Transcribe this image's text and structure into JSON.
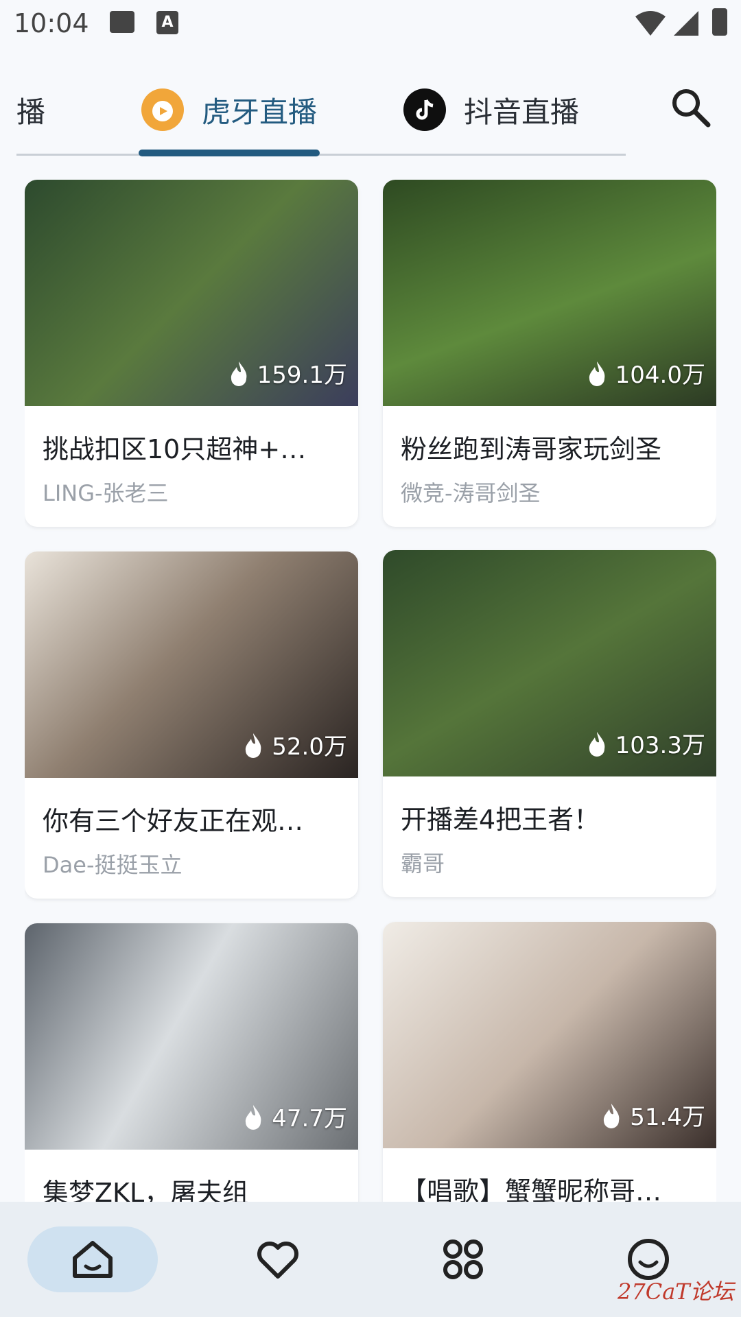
{
  "status_bar": {
    "time": "10:04",
    "icons": [
      "image-icon",
      "font-a-icon",
      "wifi-icon",
      "signal-icon",
      "battery-icon"
    ]
  },
  "tabs": [
    {
      "label": "播",
      "icon": "partial-tab",
      "active": false
    },
    {
      "label": "虎牙直播",
      "icon": "huya-logo-icon",
      "active": true
    },
    {
      "label": "抖音直播",
      "icon": "douyin-logo-icon",
      "active": false
    }
  ],
  "search": {
    "icon": "search-icon"
  },
  "cards": [
    {
      "title": "挑战扣区10只超神+…",
      "streamer": "LING-张老三",
      "viewers": "159.1万",
      "thumb_color": "#3d5a3a"
    },
    {
      "title": "粉丝跑到涛哥家玩剑圣",
      "streamer": "微竞-涛哥剑圣",
      "viewers": "104.0万",
      "thumb_color": "#3f6b34"
    },
    {
      "title": "你有三个好友正在观…",
      "streamer": "Dae-挺挺玉立",
      "viewers": "52.0万",
      "thumb_color": "#7a6a5c"
    },
    {
      "title": "开播差4把王者！",
      "streamer": "霸哥",
      "viewers": "103.3万",
      "thumb_color": "#3a5e30"
    },
    {
      "title": "集梦ZKL，屠夫组",
      "streamer": "",
      "viewers": "47.7万",
      "thumb_color": "#8b8f94"
    },
    {
      "title": "【唱歌】蟹蟹昵称哥…",
      "streamer": "",
      "viewers": "51.4万",
      "thumb_color": "#c9bdb3"
    }
  ],
  "bottom_nav": [
    {
      "name": "home",
      "icon": "home-icon",
      "active": true
    },
    {
      "name": "favorites",
      "icon": "heart-icon",
      "active": false
    },
    {
      "name": "categories",
      "icon": "grid-icon",
      "active": false
    },
    {
      "name": "profile",
      "icon": "smiley-icon",
      "active": false
    }
  ],
  "watermark": "27CaT论坛",
  "colors": {
    "accent": "#235b80",
    "nav_active_bg": "#cfe1f0",
    "card_bg": "#ffffff"
  }
}
